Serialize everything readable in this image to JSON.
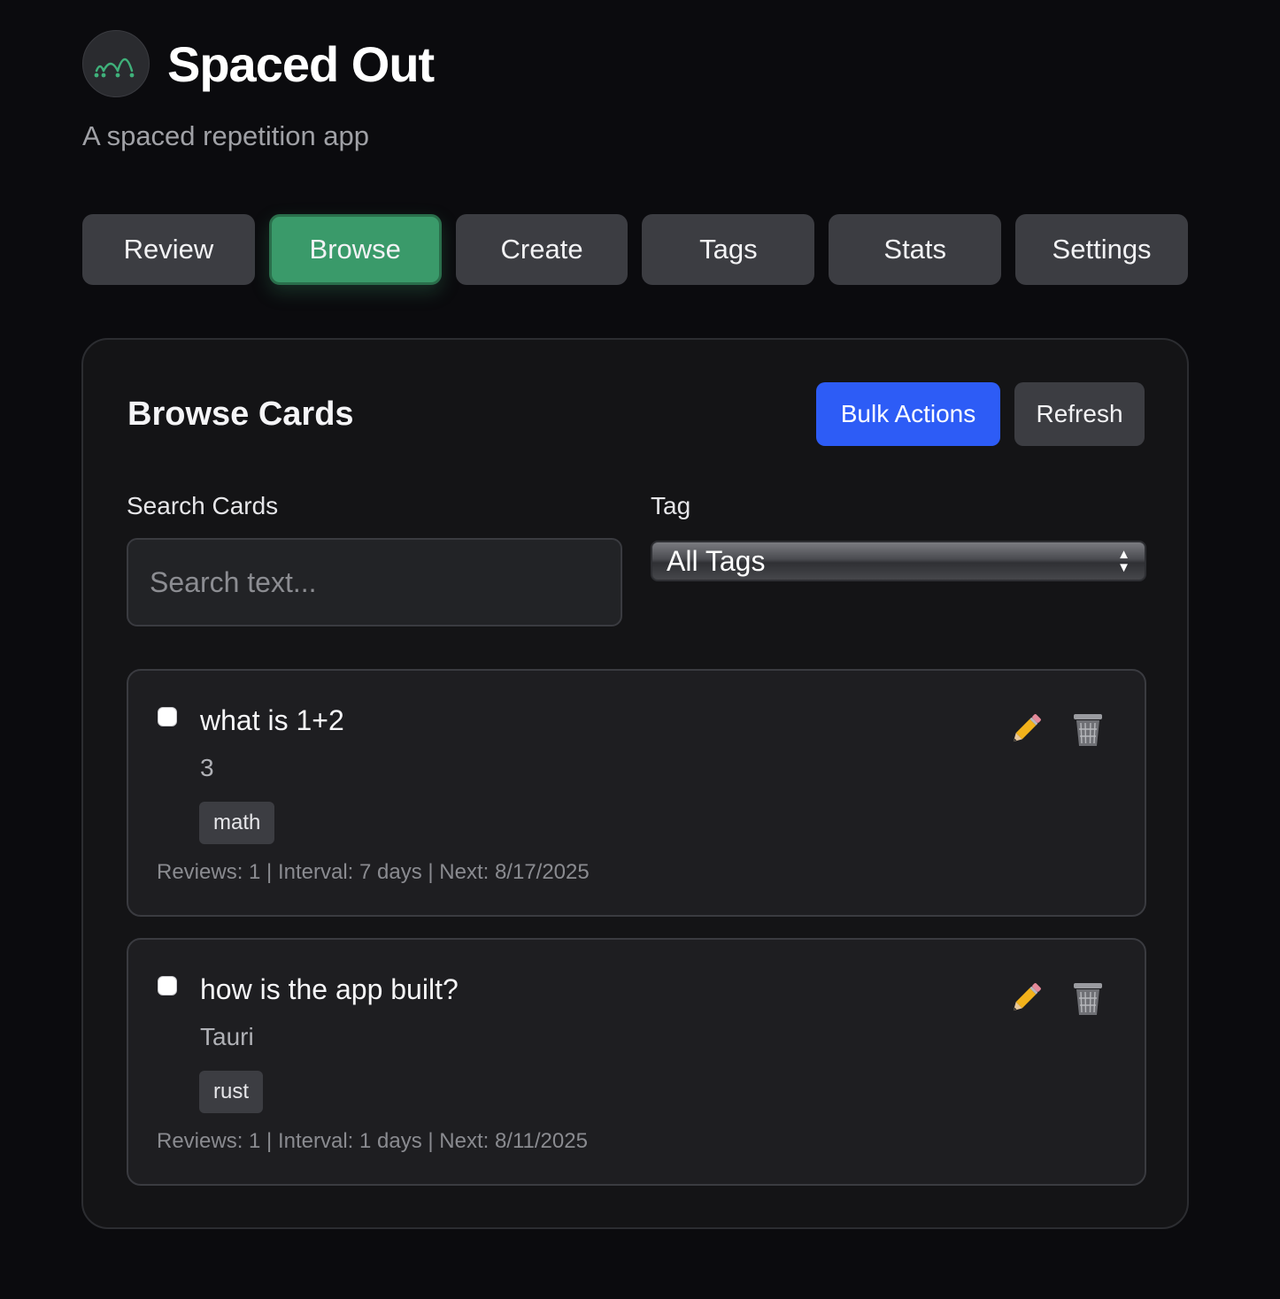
{
  "app": {
    "title": "Spaced Out",
    "subtitle": "A spaced repetition app",
    "logo_icon": "logo-arcs-icon",
    "accent_color": "#3a9a6a"
  },
  "nav": {
    "items": [
      {
        "label": "Review",
        "active": false
      },
      {
        "label": "Browse",
        "active": true
      },
      {
        "label": "Create",
        "active": false
      },
      {
        "label": "Tags",
        "active": false
      },
      {
        "label": "Stats",
        "active": false
      },
      {
        "label": "Settings",
        "active": false
      }
    ]
  },
  "browse": {
    "title": "Browse Cards",
    "bulk_actions_label": "Bulk Actions",
    "refresh_label": "Refresh",
    "search_label": "Search Cards",
    "search_placeholder": "Search text...",
    "search_value": "",
    "tag_label": "Tag",
    "tag_selected": "All Tags",
    "primary_color": "#2d5cf6",
    "cards": [
      {
        "question": "what is 1+2",
        "answer": "3",
        "tag": "math",
        "meta": "Reviews: 1 | Interval: 7 days | Next: 8/17/2025",
        "checked": false,
        "edit_icon": "pencil-icon",
        "delete_icon": "trash-icon"
      },
      {
        "question": "how is the app built?",
        "answer": "Tauri",
        "tag": "rust",
        "meta": "Reviews: 1 | Interval: 1 days | Next: 8/11/2025",
        "checked": false,
        "edit_icon": "pencil-icon",
        "delete_icon": "trash-icon"
      }
    ]
  }
}
